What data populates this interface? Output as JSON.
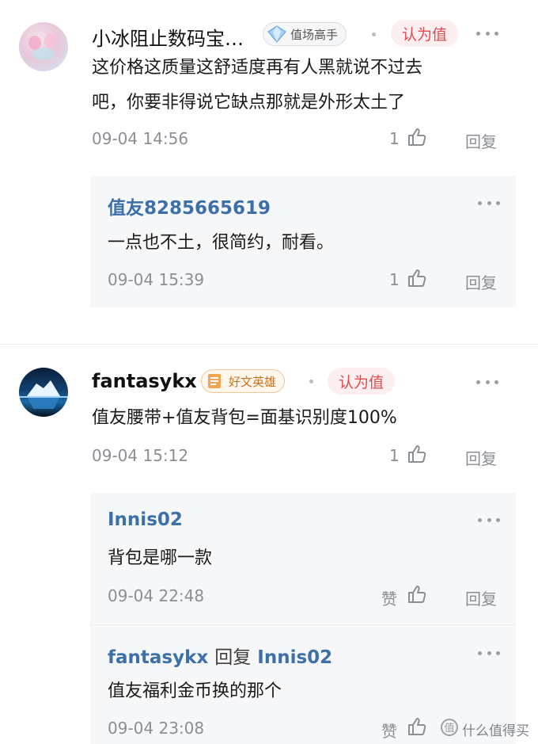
{
  "comments": [
    {
      "username": "小冰阻止数码宝…",
      "badge": "值场高手",
      "tag": "认为值",
      "text_line1": "这价格这质量这舒适度再有人黑就说不过去",
      "text_line2": "吧，你要非得说它缺点那就是外形太土了",
      "time": "09-04 14:56",
      "likes": "1",
      "reply_label": "回复",
      "replies": [
        {
          "user": "值友8285665619",
          "text": "一点也不土，很简约，耐看。",
          "time": "09-04 15:39",
          "likes": "1",
          "reply_label": "回复"
        }
      ]
    },
    {
      "username": "fantasykx",
      "badge": "好文英雄",
      "tag": "认为值",
      "text_line1": "值友腰带+值友背包=面基识别度100%",
      "time": "09-04 15:12",
      "likes": "1",
      "reply_label": "回复",
      "replies": [
        {
          "user": "Innis02",
          "text": "背包是哪一款",
          "time": "09-04 22:48",
          "likes": "赞",
          "reply_label": "回复"
        },
        {
          "user": "fantasykx",
          "reply_word": "回复",
          "reply_to": "Innis02",
          "text": "值友福利金币换的那个",
          "time": "09-04 23:08",
          "likes": "赞",
          "watermark": "什么值得买"
        }
      ]
    }
  ],
  "icons": {
    "thumb": "thumbs-up-icon",
    "more": "more-dots-icon",
    "diamond": "diamond-icon",
    "scroll": "scroll-icon"
  },
  "colors": {
    "link_blue": "#3d6fa8",
    "tag_red": "#e5484d",
    "meta_gray": "#8a8f95",
    "reply_bg": "#f6f7f9"
  }
}
